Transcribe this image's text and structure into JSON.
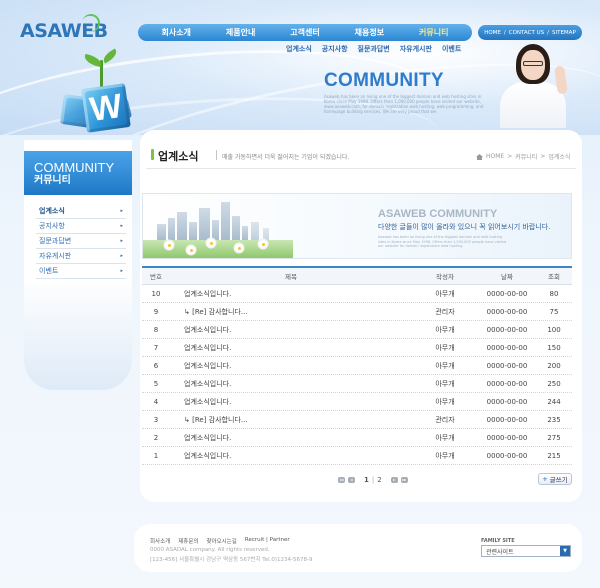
{
  "brand": {
    "logo": "ASAWEB"
  },
  "top_menu": [
    {
      "label": "회사소개",
      "active": false
    },
    {
      "label": "제품안내",
      "active": false
    },
    {
      "label": "고객센터",
      "active": false
    },
    {
      "label": "채용정보",
      "active": false
    },
    {
      "label": "커뮤니티",
      "active": true
    }
  ],
  "util_menu": {
    "home": "HOME",
    "contact": "CONTACT US",
    "sitemap": "SITEMAP",
    "sep": "/"
  },
  "sub_menu": [
    "업계소식",
    "공지사항",
    "질문과답변",
    "자유게시판",
    "이벤트"
  ],
  "hero": {
    "title": "COMMUNITY",
    "desc": "Asaweb has been an living one of the biggest domain and web hosting sites in Korea since May 1998. Offers than 1,000,000 people have visited our website, www.asaweb.com, for domain registration web hosting, web programming, and homepage building services. We are very proud that we"
  },
  "sidebar": {
    "title_en": "COMMUNITY",
    "title_ko": "커뮤니티",
    "items": [
      {
        "label": "업계소식",
        "active": true
      },
      {
        "label": "공지사항",
        "active": false
      },
      {
        "label": "질문과답변",
        "active": false
      },
      {
        "label": "자유게시판",
        "active": false
      },
      {
        "label": "이벤트",
        "active": false
      }
    ],
    "arrow": "▸"
  },
  "page": {
    "title": "업계소식",
    "desc": "매출 가동하면서 더욱 젊어지는 기업이 되겠습니다.",
    "breadcrumb": [
      "HOME",
      "커뮤니티",
      "업계소식"
    ],
    "breadcrumb_sep": ">"
  },
  "banner": {
    "title": "ASAWEB COMMUNITY",
    "subtitle": "다양한 글들이 많이 올라와 있으니 꼭 읽어보시기 바랍니다.",
    "tiny": "Asaweb has been an living one of the biggest domain and web hosting sites in Korea since May 1998. Offers than 1,000,000 people have visited our website for domain registration web hosting."
  },
  "board": {
    "columns": {
      "no": "번호",
      "title": "제목",
      "author": "작성자",
      "date": "날짜",
      "views": "조회"
    },
    "rows": [
      {
        "no": "10",
        "title": "업계소식입니다.",
        "author": "아무개",
        "date": "0000-00-00",
        "views": "80"
      },
      {
        "no": "9",
        "title": "↳ [Re] 감사합니다...",
        "author": "관리자",
        "date": "0000-00-00",
        "views": "75"
      },
      {
        "no": "8",
        "title": "업계소식입니다.",
        "author": "아무개",
        "date": "0000-00-00",
        "views": "100"
      },
      {
        "no": "7",
        "title": "업계소식입니다.",
        "author": "아무개",
        "date": "0000-00-00",
        "views": "150"
      },
      {
        "no": "6",
        "title": "업계소식입니다.",
        "author": "아무개",
        "date": "0000-00-00",
        "views": "200"
      },
      {
        "no": "5",
        "title": "업계소식입니다.",
        "author": "아무개",
        "date": "0000-00-00",
        "views": "250"
      },
      {
        "no": "4",
        "title": "업계소식입니다.",
        "author": "아무개",
        "date": "0000-00-00",
        "views": "244"
      },
      {
        "no": "3",
        "title": "↳ [Re] 감사합니다...",
        "author": "관리자",
        "date": "0000-00-00",
        "views": "235"
      },
      {
        "no": "2",
        "title": "업계소식입니다.",
        "author": "아무개",
        "date": "0000-00-00",
        "views": "275"
      },
      {
        "no": "1",
        "title": "업계소식입니다.",
        "author": "아무개",
        "date": "0000-00-00",
        "views": "215"
      }
    ]
  },
  "pager": {
    "page1": "1",
    "sep": "|",
    "page2": "2",
    "first": "◂◂",
    "prev": "◂",
    "next": "▸",
    "last": "▸▸"
  },
  "write_button": {
    "icon": "+",
    "label": "글쓰기"
  },
  "footer": {
    "links": [
      "회사소개",
      "제휴문의",
      "찾아오시는길",
      "Recruit | Partner"
    ],
    "copyright": "0000 ASADAL company. All rights reserved.",
    "address": "[123-456] 서울특별시 강남구 역삼동 567번지 Tel.0)1234-5678-9",
    "family_label": "FAMILY SITE",
    "family_select": "관련사이트"
  },
  "icons": {
    "home": "home-icon",
    "dropdown": "chevron-down-icon"
  }
}
